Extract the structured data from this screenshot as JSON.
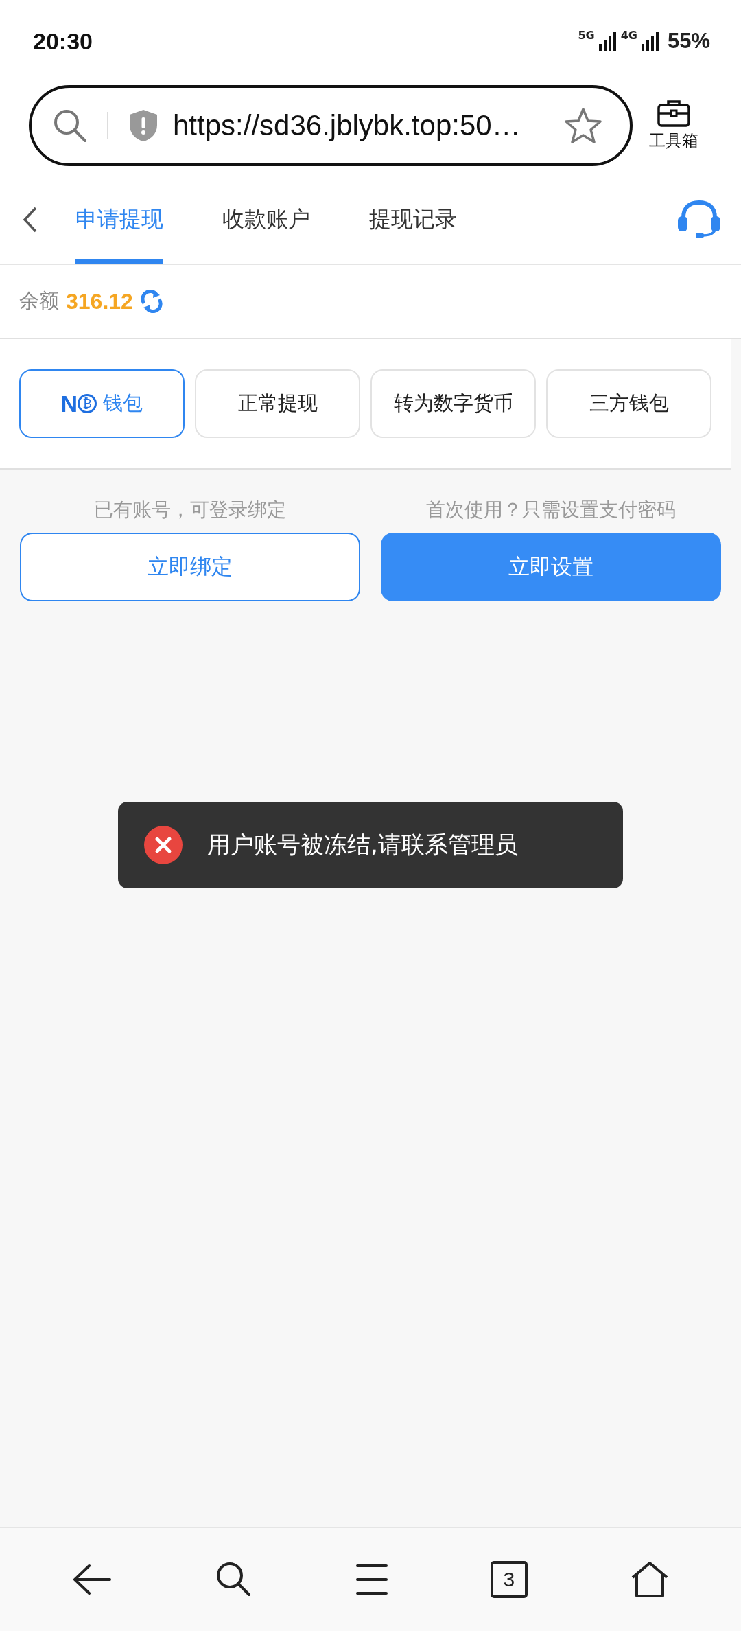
{
  "status_bar": {
    "time": "20:30",
    "network_1": "5G",
    "network_2": "4G",
    "battery": "55%"
  },
  "address_bar": {
    "url": "https://sd36.jblybk.top:50…",
    "toolbox_label": "工具箱"
  },
  "tabs": [
    {
      "label": "申请提现",
      "selected": true
    },
    {
      "label": "收款账户",
      "selected": false
    },
    {
      "label": "提现记录",
      "selected": false
    }
  ],
  "balance": {
    "label": "余额",
    "amount": "316.12"
  },
  "methods": [
    {
      "kind": "logo",
      "logo": "N",
      "coin": "₿",
      "label": "钱包",
      "selected": true
    },
    {
      "kind": "text",
      "label": "正常提现",
      "selected": false
    },
    {
      "kind": "text",
      "label": "转为数字货币",
      "selected": false
    },
    {
      "kind": "text",
      "label": "三方钱包",
      "selected": false
    }
  ],
  "actions": [
    {
      "hint": "已有账号，可登录绑定",
      "label": "立即绑定",
      "kind": "outline"
    },
    {
      "hint": "首次使用？只需设置支付密码",
      "label": "立即设置",
      "kind": "solid"
    }
  ],
  "toast": {
    "message": "用户账号被冻结,请联系管理员"
  },
  "bottom_nav": {
    "tab_count": "3"
  }
}
